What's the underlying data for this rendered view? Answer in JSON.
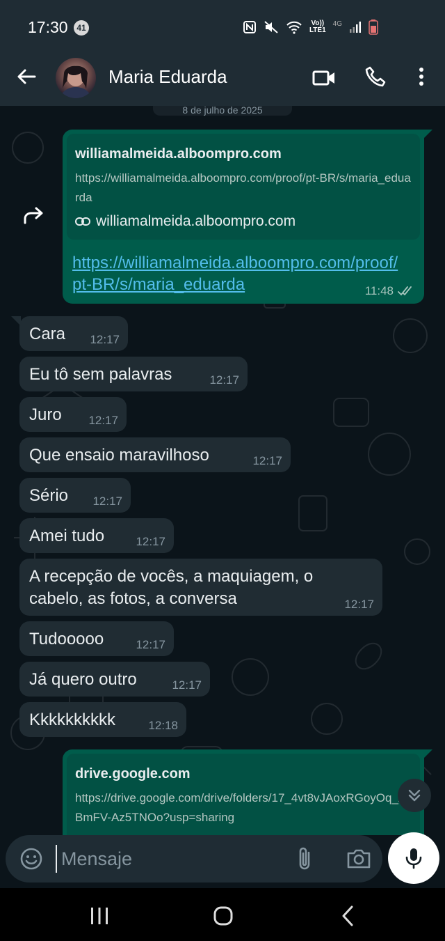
{
  "status_bar": {
    "time": "17:30",
    "notification_count": "41",
    "icons": [
      "nfc-icon",
      "mute-icon",
      "wifi-icon",
      "volte-icon",
      "4g-signal-icon",
      "battery-low-icon"
    ],
    "volte_label": "Vo))\nLTE1",
    "network_label": "4G"
  },
  "header": {
    "contact_name": "Maria Eduarda"
  },
  "chat": {
    "date_chip": "8 de julho de 2025",
    "link_message_1": {
      "preview_domain": "williamalmeida.alboompro.com",
      "preview_url": "https://williamalmeida.alboompro.com/proof/pt-BR/s/maria_eduarda",
      "preview_site": "williamalmeida.alboompro.com",
      "link_text": "https://williamalmeida.alboompro.com/proof/pt-BR/s/maria_eduarda",
      "time": "11:48"
    },
    "incoming": [
      {
        "text": "Cara",
        "time": "12:17"
      },
      {
        "text": "Eu tô sem palavras",
        "time": "12:17"
      },
      {
        "text": "Juro",
        "time": "12:17"
      },
      {
        "text": "Que ensaio maravilhoso",
        "time": "12:17"
      },
      {
        "text": "Sério",
        "time": "12:17"
      },
      {
        "text": "Amei tudo",
        "time": "12:17"
      },
      {
        "text": "A recepção de vocês, a maquiagem, o",
        "text2": "cabelo, as fotos, a conversa",
        "time": "12:17"
      },
      {
        "text": "Tudooooo",
        "time": "12:17"
      },
      {
        "text": "Já quero outro",
        "time": "12:17"
      },
      {
        "text": "Kkkkkkkkkk",
        "time": "12:18"
      }
    ],
    "link_message_2": {
      "preview_domain": "drive.google.com",
      "preview_url": "https://drive.google.com/drive/folders/17_4vt8vJAoxRGoyOq_A4BmFV-Az5TNOo?usp=sharing"
    }
  },
  "input": {
    "placeholder": "Mensaje"
  },
  "colors": {
    "accent": "#00a884",
    "outgoing_bubble": "#005c4b",
    "incoming_bubble": "#202c33",
    "link": "#53bdeb"
  }
}
